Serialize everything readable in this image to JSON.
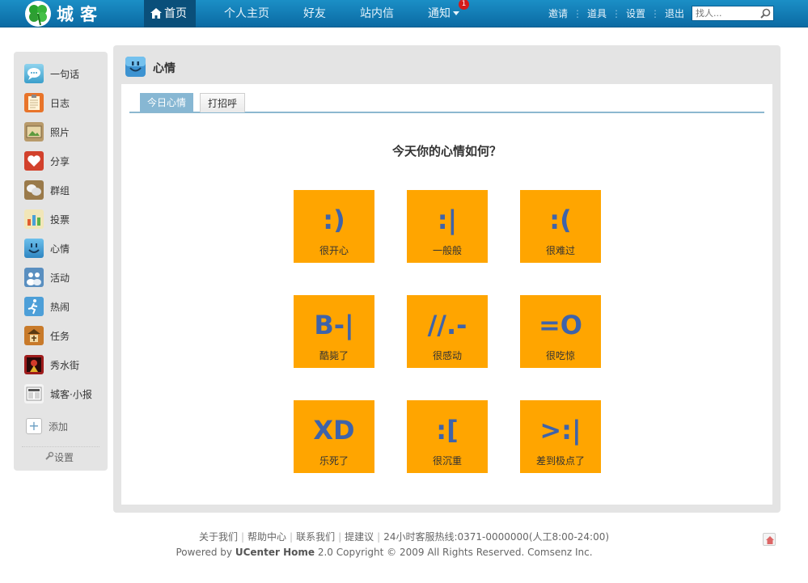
{
  "brand": {
    "logo_text": "城客"
  },
  "nav": {
    "home": "首页",
    "profile": "个人主页",
    "friends": "好友",
    "messages": "站内信",
    "notify": "通知",
    "notify_count": "1"
  },
  "toplinks": {
    "invite": "邀请",
    "tools": "道具",
    "settings": "设置",
    "logout": "退出"
  },
  "search": {
    "placeholder": "找人..."
  },
  "sidebar": {
    "items": [
      {
        "label": "一句话",
        "icon": "speech-bubble-icon"
      },
      {
        "label": "日志",
        "icon": "notepad-icon"
      },
      {
        "label": "照片",
        "icon": "photo-icon"
      },
      {
        "label": "分享",
        "icon": "heart-icon"
      },
      {
        "label": "群组",
        "icon": "group-icon"
      },
      {
        "label": "投票",
        "icon": "bar-chart-icon"
      },
      {
        "label": "心情",
        "icon": "smiley-icon"
      },
      {
        "label": "活动",
        "icon": "people-icon"
      },
      {
        "label": "热闹",
        "icon": "runner-icon"
      },
      {
        "label": "任务",
        "icon": "task-icon"
      },
      {
        "label": "秀水街",
        "icon": "shop-icon"
      },
      {
        "label": "城客·小报",
        "icon": "newspaper-icon"
      }
    ],
    "add_label": "添加",
    "settings_label": "设置"
  },
  "panel": {
    "title": "心情",
    "tabs": [
      "今日心情",
      "打招呼"
    ],
    "question": "今天你的心情如何？",
    "moods": [
      {
        "face": ":)",
        "label": "很开心"
      },
      {
        "face": ":|",
        "label": "一般般"
      },
      {
        "face": ":(",
        "label": "很难过"
      },
      {
        "face": "B-|",
        "label": "酷毙了"
      },
      {
        "face": "//.-",
        "label": "很感动"
      },
      {
        "face": "=O",
        "label": "很吃惊"
      },
      {
        "face": "XD",
        "label": "乐死了"
      },
      {
        "face": ":[",
        "label": "很沉重"
      },
      {
        "face": ">:|",
        "label": "差到极点了"
      }
    ]
  },
  "footer": {
    "links": [
      "关于我们",
      "帮助中心",
      "联系我们",
      "提建议",
      "24小时客服热线:0371-0000000(人工8:00-24:00)"
    ],
    "powered_prefix": "Powered by",
    "powered_brand": "UCenter Home",
    "powered_suffix": "2.0 Copyright © 2009 All Rights Reserved. Comsenz Inc."
  },
  "colors": {
    "topbar": "#1182bd",
    "mood_tile": "#ffa500",
    "mood_face": "#3e63aa",
    "tab_active": "#87b7d3"
  }
}
